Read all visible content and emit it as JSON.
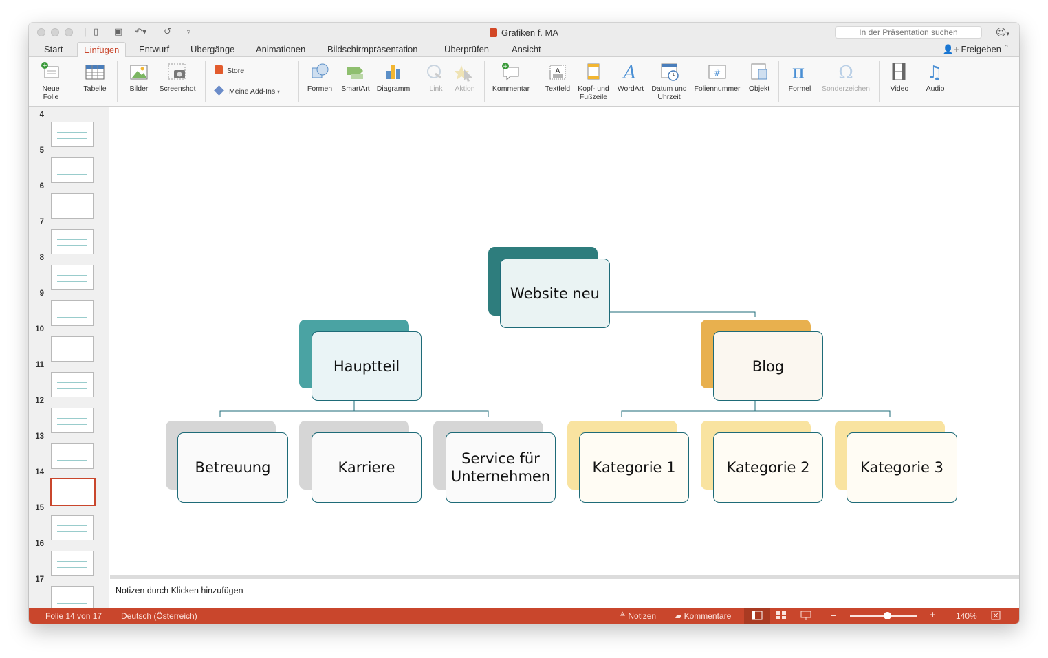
{
  "window": {
    "title": "Grafiken f. MA",
    "search_placeholder": "In der Präsentation suchen"
  },
  "tabs": [
    "Start",
    "Einfügen",
    "Entwurf",
    "Übergänge",
    "Animationen",
    "Bildschirmpräsentation",
    "Überprüfen",
    "Ansicht"
  ],
  "active_tab": "Einfügen",
  "share_label": "Freigeben",
  "ribbon": {
    "neue_folie": "Neue\nFolie",
    "tabelle": "Tabelle",
    "bilder": "Bilder",
    "screenshot": "Screenshot",
    "store": "Store",
    "addins": "Meine Add-Ins",
    "formen": "Formen",
    "smartart": "SmartArt",
    "diagramm": "Diagramm",
    "link": "Link",
    "aktion": "Aktion",
    "kommentar": "Kommentar",
    "textfeld": "Textfeld",
    "kopf_fuss": "Kopf- und\nFußzeile",
    "wordart": "WordArt",
    "datum": "Datum und\nUhrzeit",
    "foliennummer": "Foliennummer",
    "objekt": "Objekt",
    "formel": "Formel",
    "sonderzeichen": "Sonderzeichen",
    "video": "Video",
    "audio": "Audio"
  },
  "slides": [
    {
      "num": "4"
    },
    {
      "num": "5"
    },
    {
      "num": "6"
    },
    {
      "num": "7"
    },
    {
      "num": "8"
    },
    {
      "num": "9"
    },
    {
      "num": "10"
    },
    {
      "num": "11"
    },
    {
      "num": "12"
    },
    {
      "num": "13"
    },
    {
      "num": "14",
      "selected": true
    },
    {
      "num": "15"
    },
    {
      "num": "16"
    },
    {
      "num": "17"
    }
  ],
  "org_chart": {
    "root": "Website neu",
    "left": "Hauptteil",
    "right": "Blog",
    "left_children": [
      "Betreuung",
      "Karriere",
      "Service für Unternehmen"
    ],
    "right_children": [
      "Kategorie 1",
      "Kategorie 2",
      "Kategorie 3"
    ]
  },
  "notes_placeholder": "Notizen durch Klicken hinzufügen",
  "status": {
    "slide": "Folie 14 von 17",
    "language": "Deutsch (Österreich)",
    "notes": "Notizen",
    "comments": "Kommentare",
    "zoom": "140%",
    "zoom_fraction": 0.55
  },
  "colors": {
    "accent": "#c9462c",
    "root_back": "#2e7d7d",
    "level1_left_back": "#4aa3a3",
    "level1_right_back": "#e8b04e",
    "level2_left_back": "#d6d6d6",
    "level2_right_back": "#f9e3a0",
    "line": "#1e6b78"
  }
}
